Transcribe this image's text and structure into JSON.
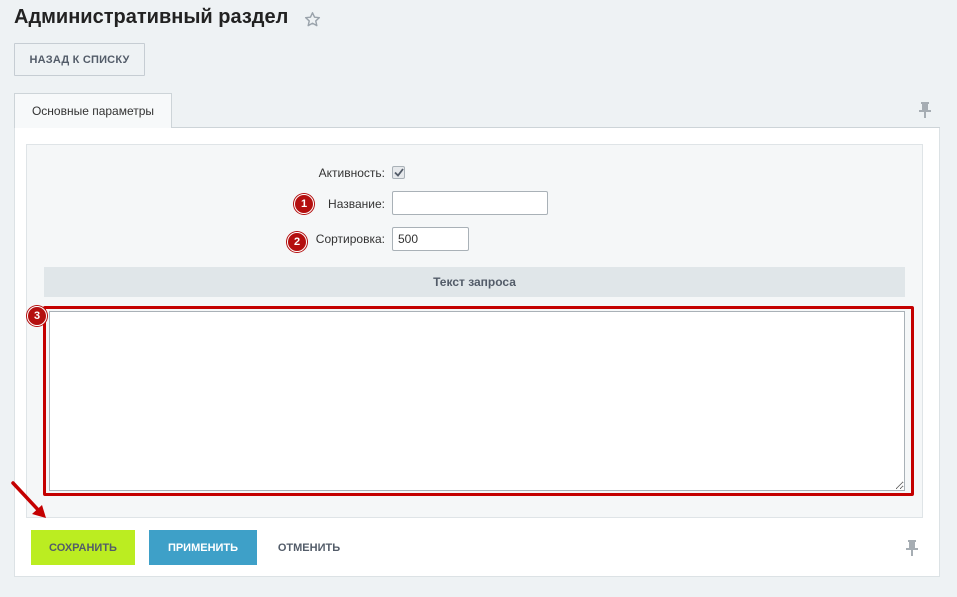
{
  "header": {
    "title": "Административный раздел",
    "favorite_icon": "star-icon"
  },
  "toolbar": {
    "back_label": "НАЗАД К СПИСКУ"
  },
  "tabs": [
    {
      "label": "Основные параметры",
      "active": true
    }
  ],
  "form": {
    "active": {
      "label": "Активность:",
      "checked": true
    },
    "name": {
      "label": "Название:",
      "value": "",
      "badge": "1"
    },
    "sort": {
      "label": "Сортировка:",
      "value": "500",
      "badge": "2"
    },
    "query_section": {
      "title": "Текст запроса",
      "value": "",
      "badge": "3"
    }
  },
  "footer": {
    "save_label": "СОХРАНИТЬ",
    "apply_label": "ПРИМЕНИТЬ",
    "cancel_label": "ОТМЕНИТЬ"
  },
  "colors": {
    "save": "#bbed21",
    "apply": "#3ea0c8",
    "annotation": "#c40000"
  }
}
